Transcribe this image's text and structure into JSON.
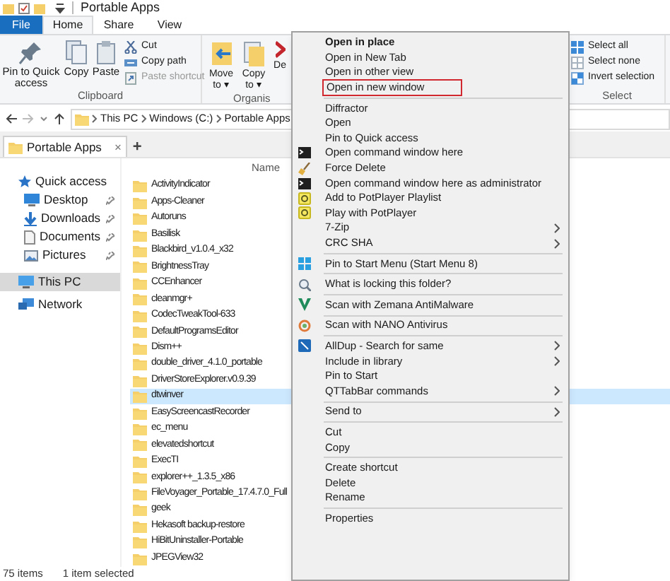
{
  "window": {
    "title": "Portable Apps"
  },
  "ribbon_tabs": [
    {
      "label": "File",
      "selected": false,
      "kind": "file"
    },
    {
      "label": "Home",
      "selected": true,
      "kind": "tab"
    },
    {
      "label": "Share",
      "selected": false,
      "kind": "tab"
    },
    {
      "label": "View",
      "selected": false,
      "kind": "tab"
    }
  ],
  "ribbon": {
    "clipboard": {
      "large": [
        {
          "label": "Pin to Quick access",
          "disabled": false
        },
        {
          "label": "Copy",
          "disabled": false
        },
        {
          "label": "Paste",
          "disabled": false
        }
      ],
      "small": [
        {
          "label": "Cut",
          "disabled": false
        },
        {
          "label": "Copy path",
          "disabled": false
        },
        {
          "label": "Paste shortcut",
          "disabled": true
        }
      ],
      "group_label": "Clipboard"
    },
    "organise": {
      "large": [
        {
          "label": "Move to ▾"
        },
        {
          "label": "Copy to ▾"
        },
        {
          "label": "De"
        }
      ],
      "group_label": "Organis"
    },
    "select": {
      "small": [
        {
          "label": "Select all"
        },
        {
          "label": "Select none"
        },
        {
          "label": "Invert selection"
        }
      ],
      "group_label": "Select"
    }
  },
  "address_bar": {
    "path": [
      "This PC",
      "Windows (C:)",
      "Portable Apps"
    ]
  },
  "tabs": [
    {
      "label": "Portable Apps",
      "close": "×",
      "selected": true
    }
  ],
  "new_tab": "+",
  "navigation": [
    {
      "label": "Quick access",
      "pinned": false,
      "selected": false,
      "children": [
        {
          "label": "Desktop",
          "pinned": true,
          "selected": false
        },
        {
          "label": "Downloads",
          "pinned": true,
          "selected": false
        },
        {
          "label": "Documents",
          "pinned": true,
          "selected": false
        },
        {
          "label": "Pictures",
          "pinned": true,
          "selected": false
        }
      ]
    },
    {
      "label": "This PC",
      "pinned": false,
      "selected": true
    },
    {
      "label": "Network",
      "pinned": false,
      "selected": false
    }
  ],
  "file_list": {
    "columns": [
      "Name"
    ],
    "rows": [
      {
        "name": "ActivityIndicator",
        "selected": false
      },
      {
        "name": "Apps-Cleaner",
        "selected": false
      },
      {
        "name": "Autoruns",
        "selected": false
      },
      {
        "name": "Basilisk",
        "selected": false
      },
      {
        "name": "Blackbird_v1.0.4_x32",
        "selected": false
      },
      {
        "name": "BrightnessTray",
        "selected": false
      },
      {
        "name": "CCEnhancer",
        "selected": false
      },
      {
        "name": "cleanmgr+",
        "selected": false
      },
      {
        "name": "CodecTweakTool-633",
        "selected": false
      },
      {
        "name": "DefaultProgramsEditor",
        "selected": false
      },
      {
        "name": "Dism++",
        "selected": false
      },
      {
        "name": "double_driver_4.1.0_portable",
        "selected": false
      },
      {
        "name": "DriverStoreExplorer.v0.9.39",
        "selected": false
      },
      {
        "name": "dtwinver",
        "selected": true
      },
      {
        "name": "EasyScreencastRecorder",
        "selected": false
      },
      {
        "name": "ec_menu",
        "selected": false
      },
      {
        "name": "elevatedshortcut",
        "selected": false
      },
      {
        "name": "ExecTI",
        "selected": false
      },
      {
        "name": "explorer++_1.3.5_x86",
        "selected": false
      },
      {
        "name": "FileVoyager_Portable_17.4.7.0_Full",
        "selected": false
      },
      {
        "name": "geek",
        "selected": false
      },
      {
        "name": "Hekasoft backup-restore",
        "selected": false
      },
      {
        "name": "HiBitUninstaller-Portable",
        "selected": false
      },
      {
        "name": "JPEGView32",
        "selected": false
      }
    ]
  },
  "status_bar": {
    "count": "75 items",
    "selection": "1 item selected"
  },
  "context_menu": [
    {
      "kind": "item",
      "label": "Open in place",
      "default": true,
      "submenu": false,
      "highlighted": false
    },
    {
      "kind": "item",
      "label": "Open in New Tab",
      "default": false,
      "submenu": false,
      "highlighted": false
    },
    {
      "kind": "item",
      "label": "Open in other view",
      "default": false,
      "submenu": false,
      "highlighted": false
    },
    {
      "kind": "item",
      "label": "Open in new window",
      "default": false,
      "submenu": false,
      "highlighted": true
    },
    {
      "kind": "separator"
    },
    {
      "kind": "item",
      "label": "Diffractor",
      "default": false,
      "submenu": false,
      "highlighted": false
    },
    {
      "kind": "item",
      "label": "Open",
      "default": false,
      "submenu": false,
      "highlighted": false
    },
    {
      "kind": "item",
      "label": "Pin to Quick access",
      "default": false,
      "submenu": false,
      "highlighted": false
    },
    {
      "kind": "item",
      "label": "Open command window here",
      "default": false,
      "submenu": false,
      "highlighted": false
    },
    {
      "kind": "item",
      "label": "Force Delete",
      "default": false,
      "submenu": false,
      "highlighted": false
    },
    {
      "kind": "item",
      "label": "Open command window here as administrator",
      "default": false,
      "submenu": false,
      "highlighted": false
    },
    {
      "kind": "item",
      "label": "Add to PotPlayer Playlist",
      "default": false,
      "submenu": false,
      "highlighted": false
    },
    {
      "kind": "item",
      "label": "Play with PotPlayer",
      "default": false,
      "submenu": false,
      "highlighted": false
    },
    {
      "kind": "item",
      "label": "7-Zip",
      "default": false,
      "submenu": true,
      "highlighted": false
    },
    {
      "kind": "item",
      "label": "CRC SHA",
      "default": false,
      "submenu": true,
      "highlighted": false
    },
    {
      "kind": "separator"
    },
    {
      "kind": "item",
      "label": "Pin to Start Menu (Start Menu 8)",
      "default": false,
      "submenu": false,
      "highlighted": false
    },
    {
      "kind": "separator"
    },
    {
      "kind": "item",
      "label": "What is locking this folder?",
      "default": false,
      "submenu": false,
      "highlighted": false
    },
    {
      "kind": "separator"
    },
    {
      "kind": "item",
      "label": "Scan with Zemana AntiMalware",
      "default": false,
      "submenu": false,
      "highlighted": false
    },
    {
      "kind": "separator"
    },
    {
      "kind": "item",
      "label": "Scan with NANO Antivirus",
      "default": false,
      "submenu": false,
      "highlighted": false
    },
    {
      "kind": "separator"
    },
    {
      "kind": "item",
      "label": "AllDup - Search for same",
      "default": false,
      "submenu": true,
      "highlighted": false
    },
    {
      "kind": "item",
      "label": "Include in library",
      "default": false,
      "submenu": true,
      "highlighted": false
    },
    {
      "kind": "item",
      "label": "Pin to Start",
      "default": false,
      "submenu": false,
      "highlighted": false
    },
    {
      "kind": "item",
      "label": "QTTabBar commands",
      "default": false,
      "submenu": true,
      "highlighted": false
    },
    {
      "kind": "separator"
    },
    {
      "kind": "item",
      "label": "Send to",
      "default": false,
      "submenu": true,
      "highlighted": false
    },
    {
      "kind": "separator"
    },
    {
      "kind": "item",
      "label": "Cut",
      "default": false,
      "submenu": false,
      "highlighted": false
    },
    {
      "kind": "item",
      "label": "Copy",
      "default": false,
      "submenu": false,
      "highlighted": false
    },
    {
      "kind": "separator"
    },
    {
      "kind": "item",
      "label": "Create shortcut",
      "default": false,
      "submenu": false,
      "highlighted": false
    },
    {
      "kind": "item",
      "label": "Delete",
      "default": false,
      "submenu": false,
      "highlighted": false
    },
    {
      "kind": "item",
      "label": "Rename",
      "default": false,
      "submenu": false,
      "highlighted": false
    },
    {
      "kind": "separator"
    },
    {
      "kind": "item",
      "label": "Properties",
      "default": false,
      "submenu": false,
      "highlighted": false
    }
  ]
}
